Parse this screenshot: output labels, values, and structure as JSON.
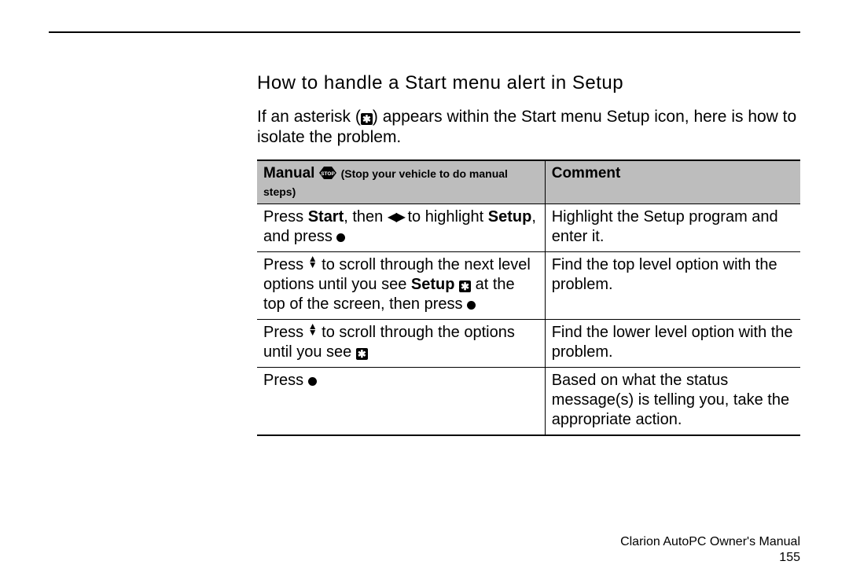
{
  "heading": "How to handle a Start menu alert in Setup",
  "intro": {
    "pre": "If an asterisk (",
    "post": ") appears within the Start menu Setup icon, here is how to isolate the problem."
  },
  "table": {
    "header": {
      "manual_label": "Manual",
      "manual_sub_pre": "(Stop your vehicle to do manual",
      "manual_sub_post": "steps)",
      "comment_label": "Comment"
    },
    "rows": [
      {
        "manual": {
          "a": "Press ",
          "b": "Start",
          "c": ", then ",
          "d": " to highlight ",
          "e": "Setup",
          "f": ", and press "
        },
        "comment": "Highlight the Setup program and enter it."
      },
      {
        "manual": {
          "a": "Press ",
          "b": " to scroll through the next level options until you see ",
          "c": "Setup",
          "d": " at the top of the screen, then press "
        },
        "comment": "Find the top level option with the problem."
      },
      {
        "manual": {
          "a": "Press ",
          "b": " to scroll through the options until you see "
        },
        "comment": "Find the lower level option with the problem."
      },
      {
        "manual": {
          "a": "Press "
        },
        "comment": "Based on what the status message(s) is telling you, take the appropriate action."
      }
    ]
  },
  "footer": {
    "line1": "Clarion AutoPC Owner's Manual",
    "line2": "155"
  },
  "icons": {
    "asterisk": "✱",
    "stop": "STOP"
  }
}
